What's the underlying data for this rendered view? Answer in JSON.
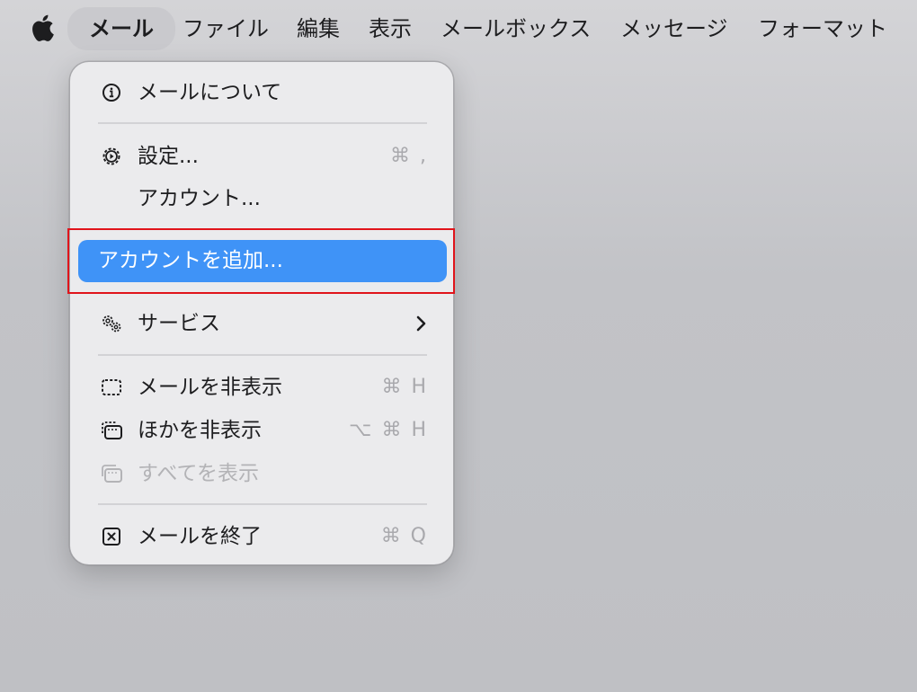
{
  "menubar": {
    "apple_icon": "apple-logo-icon",
    "items": [
      {
        "label": "メール",
        "active": true
      },
      {
        "label": "ファイル"
      },
      {
        "label": "編集"
      },
      {
        "label": "表示"
      },
      {
        "label": "メールボックス"
      },
      {
        "label": "メッセージ"
      },
      {
        "label": "フォーマット"
      }
    ]
  },
  "menu": {
    "items": {
      "about": {
        "label": "メールについて",
        "icon": "info-circle-icon"
      },
      "settings": {
        "label": "設定...",
        "icon": "gear-icon",
        "shortcut": "⌘ ,"
      },
      "accounts": {
        "label": "アカウント..."
      },
      "add_account": {
        "label": "アカウントを追加...",
        "highlighted": true
      },
      "services": {
        "label": "サービス",
        "icon": "services-gears-icon",
        "submenu": true
      },
      "hide_mail": {
        "label": "メールを非表示",
        "icon": "hide-window-icon",
        "shortcut": "⌘ H"
      },
      "hide_others": {
        "label": "ほかを非表示",
        "icon": "hide-others-icon",
        "shortcut": "⌥ ⌘ H"
      },
      "show_all": {
        "label": "すべてを表示",
        "icon": "show-all-icon",
        "disabled": true
      },
      "quit": {
        "label": "メールを終了",
        "icon": "quit-x-icon",
        "shortcut": "⌘ Q"
      }
    }
  },
  "colors": {
    "highlight": "#3f93f7",
    "annotation_box": "#e0141b",
    "menu_bg": "#ebebed"
  }
}
